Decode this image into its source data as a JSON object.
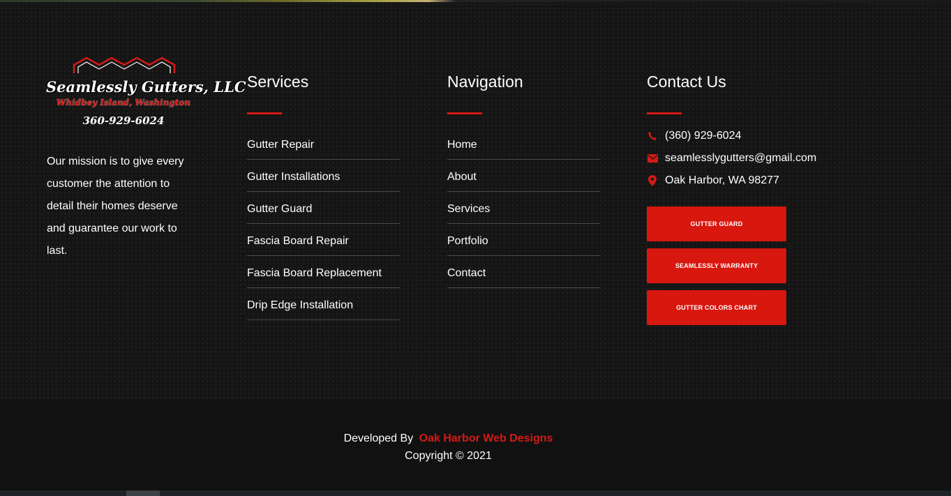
{
  "brand": {
    "name": "Seamlessly Gutters, LLC",
    "location": "Whidbey Island, Washington",
    "phone": "360-929-6024",
    "accent_color": "#d51a16"
  },
  "about": {
    "mission": "Our mission is to give every customer the attention to detail their homes deserve and guarantee our work to last."
  },
  "services": {
    "heading": "Services",
    "items": [
      {
        "label": "Gutter Repair"
      },
      {
        "label": "Gutter Installations"
      },
      {
        "label": "Gutter Guard"
      },
      {
        "label": "Fascia Board Repair"
      },
      {
        "label": "Fascia Board Replacement"
      },
      {
        "label": "Drip Edge Installation"
      }
    ]
  },
  "navigation": {
    "heading": "Navigation",
    "items": [
      {
        "label": "Home"
      },
      {
        "label": "About"
      },
      {
        "label": "Services"
      },
      {
        "label": "Portfolio"
      },
      {
        "label": "Contact"
      }
    ]
  },
  "contact": {
    "heading": "Contact Us",
    "phone": "(360) 929-6024",
    "email": "seamlesslygutters@gmail.com",
    "address": "Oak Harbor, WA 98277",
    "phone_icon": "phone-icon",
    "email_icon": "envelope-icon",
    "address_icon": "map-pin-icon",
    "buttons": [
      {
        "label": "GUTTER GUARD"
      },
      {
        "label": "SEAMLESSLY WARRANTY"
      },
      {
        "label": "GUTTER COLORS CHART"
      }
    ]
  },
  "bottom": {
    "developed_by": "Developed By",
    "developer": "Oak Harbor Web Designs",
    "copyright": "Copyright © 2021"
  }
}
